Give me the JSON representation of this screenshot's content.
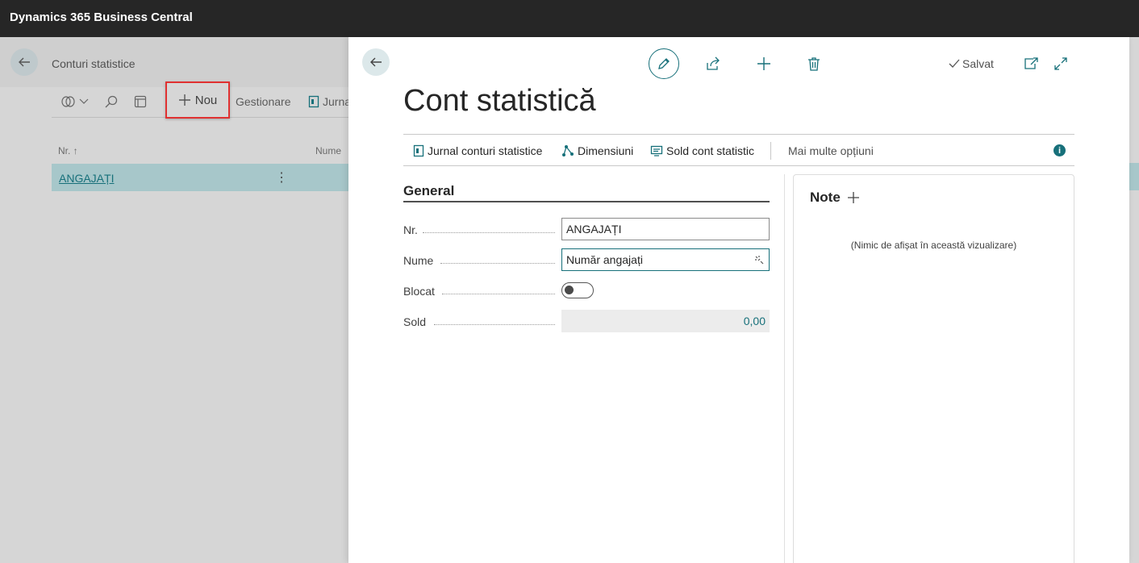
{
  "app": {
    "title": "Dynamics 365 Business Central"
  },
  "list_page": {
    "breadcrumb": "Conturi statistice",
    "toolbar": {
      "new_label": "Nou",
      "manage_label": "Gestionare",
      "journal_label": "Jurna"
    },
    "columns": {
      "no": "Nr. ↑",
      "name": "Nume"
    },
    "rows": [
      {
        "no": "ANGAJAȚI",
        "more": "⋮"
      }
    ]
  },
  "card": {
    "saved_label": "Salvat",
    "title": "Cont statistică",
    "actions": {
      "journal": "Jurnal conturi statistice",
      "dimensions": "Dimensiuni",
      "balance": "Sold cont statistic",
      "more": "Mai multe opțiuni"
    },
    "info_icon": "i",
    "general": {
      "title": "General",
      "fields": {
        "no_label": "Nr.",
        "no_value": "ANGAJAȚI",
        "name_label": "Nume",
        "name_value": "Număr angajați",
        "blocked_label": "Blocat",
        "blocked_value": false,
        "balance_label": "Sold",
        "balance_value": "0,00"
      }
    },
    "notes": {
      "title": "Note",
      "empty_text": "(Nimic de afișat în această vizualizare)"
    }
  },
  "colors": {
    "accent": "#17707a",
    "highlight": "#e03131",
    "topbar": "#262626"
  }
}
